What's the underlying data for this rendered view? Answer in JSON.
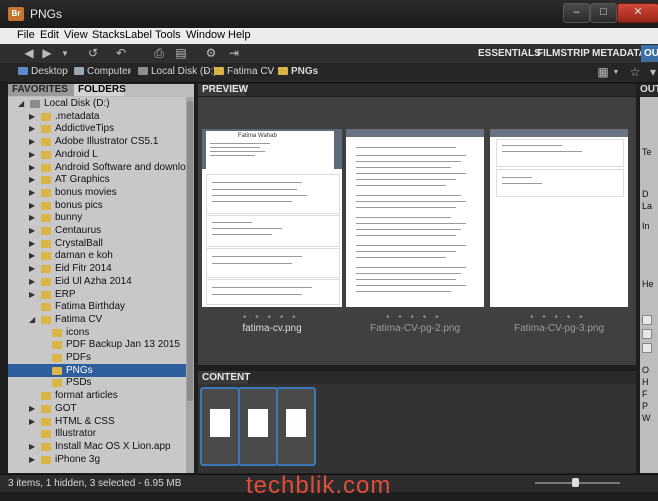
{
  "window": {
    "title": "PNGs",
    "app_badge": "Br",
    "min": "‒",
    "max": "□",
    "close": "✕"
  },
  "menu": [
    "File",
    "Edit",
    "View",
    "Stacks",
    "Label",
    "Tools",
    "Window",
    "Help"
  ],
  "workspaces": {
    "essentials": "ESSENTIALS",
    "filmstrip": "FILMSTRIP",
    "metadata": "METADATA",
    "output": "OU"
  },
  "breadcrumb": [
    "Desktop",
    "Computer",
    "Local Disk (D:)",
    "Fatima CV",
    "PNGs"
  ],
  "panels": {
    "favorites": "FAVORITES",
    "folders": "FOLDERS",
    "preview": "PREVIEW",
    "content": "CONTENT",
    "output": "OUTPUT"
  },
  "tree": [
    {
      "label": "Local Disk (D:)",
      "indent": 0,
      "expanded": true
    },
    {
      "label": ".metadata",
      "indent": 1
    },
    {
      "label": "AddictiveTips",
      "indent": 1
    },
    {
      "label": "Adobe Illustrator CS5.1",
      "indent": 1
    },
    {
      "label": "Android L",
      "indent": 1
    },
    {
      "label": "Android Software and downloads",
      "indent": 1
    },
    {
      "label": "AT Graphics",
      "indent": 1
    },
    {
      "label": "bonus movies",
      "indent": 1
    },
    {
      "label": "bonus pics",
      "indent": 1
    },
    {
      "label": "bunny",
      "indent": 1
    },
    {
      "label": "Centaurus",
      "indent": 1
    },
    {
      "label": "CrystalBall",
      "indent": 1
    },
    {
      "label": "daman e koh",
      "indent": 1
    },
    {
      "label": "Eid Fitr 2014",
      "indent": 1
    },
    {
      "label": "Eid Ul Azha 2014",
      "indent": 1
    },
    {
      "label": "ERP",
      "indent": 1
    },
    {
      "label": "Fatima Birthday",
      "indent": 1,
      "noarrow": true
    },
    {
      "label": "Fatima CV",
      "indent": 1,
      "expanded": true
    },
    {
      "label": "icons",
      "indent": 2,
      "noarrow": true
    },
    {
      "label": "PDF Backup Jan 13 2015",
      "indent": 2,
      "noarrow": true
    },
    {
      "label": "PDFs",
      "indent": 2,
      "noarrow": true
    },
    {
      "label": "PNGs",
      "indent": 2,
      "noarrow": true,
      "selected": true
    },
    {
      "label": "PSDs",
      "indent": 2,
      "noarrow": true
    },
    {
      "label": "format articles",
      "indent": 1,
      "noarrow": true
    },
    {
      "label": "GOT",
      "indent": 1
    },
    {
      "label": "HTML & CSS",
      "indent": 1
    },
    {
      "label": "Illustrator",
      "indent": 1,
      "noarrow": true
    },
    {
      "label": "Install Mac OS X Lion.app",
      "indent": 1
    },
    {
      "label": "iPhone 3g",
      "indent": 1
    }
  ],
  "preview_items": [
    {
      "name": "fatima-cv.png",
      "active": true
    },
    {
      "name": "Fatima-CV-pg-2.png",
      "active": false
    },
    {
      "name": "Fatima-CV-pg-3.png",
      "active": false
    }
  ],
  "rating_dots": "• • • • •",
  "resume_name": "Fatima Wahab",
  "right_labels": [
    "Te",
    "D",
    "La",
    "In",
    "He",
    "O",
    "H",
    "F",
    "P",
    "W"
  ],
  "status": "3 items, 1 hidden, 3 selected - 6.95 MB",
  "watermark": "techblik.com"
}
